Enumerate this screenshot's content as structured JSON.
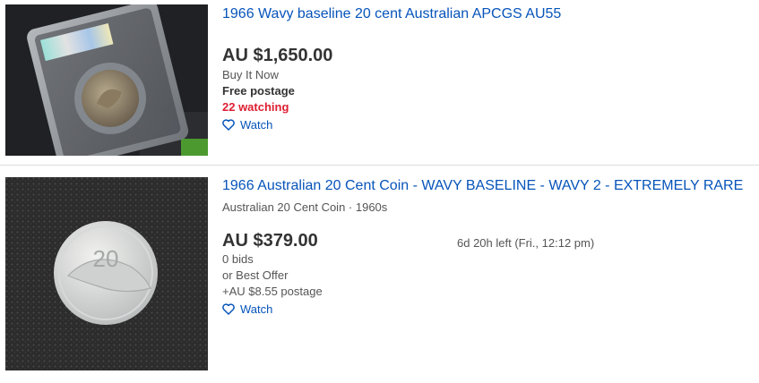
{
  "listings": [
    {
      "title": "1966 Wavy baseline 20 cent Australian APCGS AU55",
      "price": "AU $1,650.00",
      "format": "Buy It Now",
      "postage": "Free postage",
      "watching": "22 watching",
      "watch_label": "Watch"
    },
    {
      "title": "1966 Australian 20 Cent Coin - WAVY BASELINE - WAVY 2 - EXTREMELY RARE",
      "subtitle": "Australian 20 Cent Coin · 1960s",
      "price": "AU $379.00",
      "bids": "0 bids",
      "best_offer": "or Best Offer",
      "postage": "+AU $8.55 postage",
      "time_left": "6d 20h left (Fri., 12:12 pm)",
      "watch_label": "Watch"
    }
  ],
  "colors": {
    "link": "#0654ba",
    "watching": "#dd1e31",
    "text": "#333333",
    "muted": "#555555"
  },
  "icons": {
    "watch": "heart-icon"
  }
}
